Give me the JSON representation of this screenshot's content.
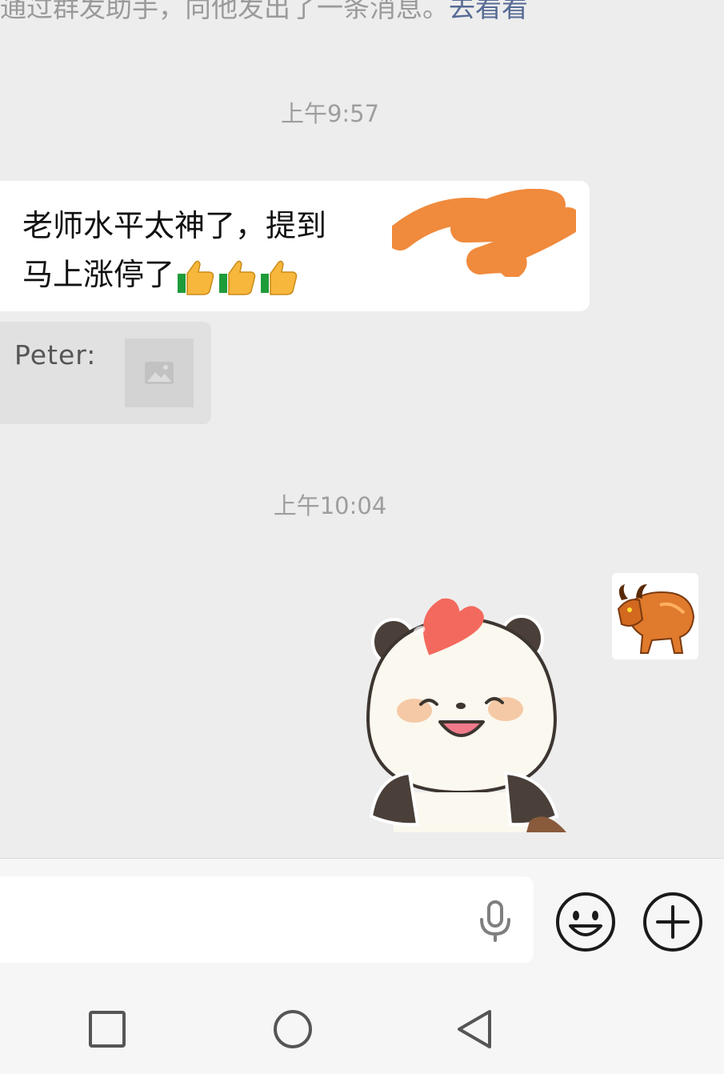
{
  "system_note": {
    "text": "通过群发助手，向他发出了一条消息。",
    "link": "去看看"
  },
  "messages": {
    "time1": "上午9:57",
    "incoming_line1": "老师水平太神了，提到",
    "incoming_line2": "马上涨停了",
    "quote_sender": "Peter:",
    "time2": "上午10:04"
  },
  "input": {
    "value": "",
    "placeholder": ""
  },
  "icons": {
    "mic": "mic-icon",
    "emoji": "smiley-icon",
    "plus": "plus-icon",
    "nav": [
      "recent-apps-icon",
      "home-icon",
      "back-icon"
    ]
  },
  "colors": {
    "chat_background": "#ededed",
    "link": "#576b95",
    "timestamp": "#9e9e9e",
    "scribble": "#f08a3c"
  }
}
